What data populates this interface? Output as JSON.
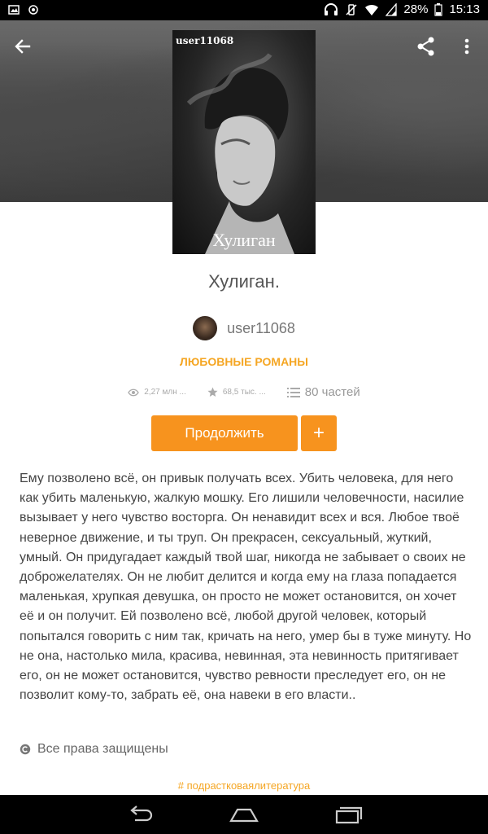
{
  "status_bar": {
    "battery": "28%",
    "time": "15:13"
  },
  "cover": {
    "author_tag": "user11068",
    "title": "Хулиган"
  },
  "book": {
    "title": "Хулиган.",
    "author": "user11068",
    "genre": "ЛЮБОВНЫЕ РОМАНЫ",
    "reads": "2,27 млн ...",
    "votes": "68,5 тыс. ...",
    "parts": "80 частей"
  },
  "actions": {
    "continue_label": "Продолжить",
    "add_label": "+"
  },
  "description": "Ему позволено всё, он привык получать всех. Убить человека, для него как убить маленькую, жалкую мошку. Его лишили человечности, насилие вызывает у него чувство восторга. Он ненавидит всех и вся. Любое твоё неверное движение, и ты труп. Он прекрасен, сексуальный, жуткий, умный. Он придугадает каждый твой шаг, никогда не забывает о своих не доброжелателях. Он не любит делится и когда ему на глаза попадается маленькая, хрупкая девушка, он просто не может остановится, он хочет её и он получит. Ей позволено всё, любой другой человек, который попытался говорить с ним так, кричать на него, умер бы в туже минуту. Но не она, настолько мила, красива, невинная, эта невинность притягивает его, он не может остановится, чувство ревности преследует его, он не позволит кому-то, забрать её, она навеки в его власти..",
  "copyright": "Все права защищены",
  "tag": "# подрастковаялитература",
  "colors": {
    "accent": "#f7931e",
    "genre": "#f5a623"
  }
}
